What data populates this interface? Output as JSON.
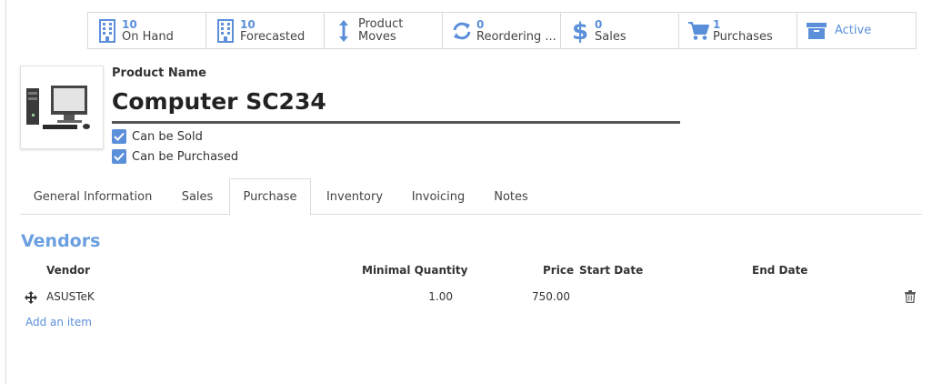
{
  "smart_buttons": [
    {
      "value": "10",
      "label": "On Hand",
      "icon": "building-icon"
    },
    {
      "value": "10",
      "label": "Forecasted",
      "icon": "building-icon"
    },
    {
      "value": "Product",
      "label": "Moves",
      "icon": "arrows-vertical-icon"
    },
    {
      "value": "0",
      "label": "Reordering ...",
      "icon": "refresh-icon"
    },
    {
      "value": "0",
      "label": "Sales",
      "icon": "dollar-icon"
    },
    {
      "value": "1",
      "label": "Purchases",
      "icon": "cart-icon"
    },
    {
      "label": "Active",
      "icon": "archive-icon"
    }
  ],
  "product": {
    "name_label": "Product Name",
    "name": "Computer SC234",
    "can_be_sold": "Can be Sold",
    "can_be_purchased": "Can be Purchased"
  },
  "tabs": [
    "General Information",
    "Sales",
    "Purchase",
    "Inventory",
    "Invoicing",
    "Notes"
  ],
  "active_tab": "Purchase",
  "vendors": {
    "title": "Vendors",
    "columns": [
      "Vendor",
      "Minimal Quantity",
      "Price",
      "Start Date",
      "End Date"
    ],
    "rows": [
      {
        "vendor": "ASUSTeK",
        "min_qty": "1.00",
        "price": "750.00",
        "start_date": "",
        "end_date": ""
      }
    ],
    "add_label": "Add an item"
  },
  "colors": {
    "accent": "#5b8fd9",
    "title": "#6a9fe0",
    "border": "#d9d9d9"
  }
}
